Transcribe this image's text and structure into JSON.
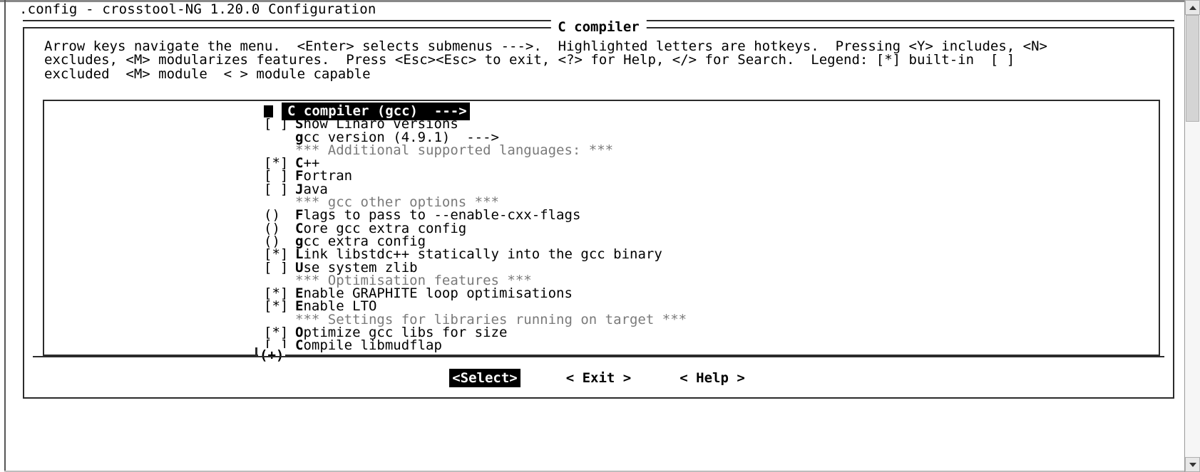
{
  "window": {
    "title": ".config - crosstool-NG 1.20.0 Configuration"
  },
  "dialog": {
    "caption": "C compiler",
    "help_lines": [
      "Arrow keys navigate the menu.  <Enter> selects submenus --->.  Highlighted letters are hotkeys.  Pressing <Y> includes, <N>",
      "excludes, <M> modularizes features.  Press <Esc><Esc> to exit, <?> for Help, </> for Search.  Legend: [*] built-in  [ ]",
      "excluded  <M> module  < > module capable"
    ],
    "more_indicator": "(+)"
  },
  "menu": {
    "items": [
      {
        "mark": "",
        "hotkey": "C",
        "rest": " compiler (gcc)",
        "arrow": "  --->",
        "kind": "submenu",
        "selected": true
      },
      {
        "mark": "[ ]",
        "hotkey": "S",
        "rest": "how Linaro versions",
        "arrow": "",
        "kind": "bool",
        "selected": false
      },
      {
        "mark": "",
        "hotkey": "g",
        "rest": "cc version (4.9.1)",
        "arrow": "  --->",
        "kind": "choice",
        "selected": false
      },
      {
        "mark": "",
        "hotkey": "",
        "rest": "*** Additional supported languages: ***",
        "arrow": "",
        "kind": "separator",
        "selected": false
      },
      {
        "mark": "[*]",
        "hotkey": "C",
        "rest": "++",
        "arrow": "",
        "kind": "bool",
        "selected": false
      },
      {
        "mark": "[ ]",
        "hotkey": "F",
        "rest": "ortran",
        "arrow": "",
        "kind": "bool",
        "selected": false
      },
      {
        "mark": "[ ]",
        "hotkey": "J",
        "rest": "ava",
        "arrow": "",
        "kind": "bool",
        "selected": false
      },
      {
        "mark": "",
        "hotkey": "",
        "rest": "*** gcc other options ***",
        "arrow": "",
        "kind": "separator",
        "selected": false
      },
      {
        "mark": "()",
        "hotkey": "F",
        "rest": "lags to pass to --enable-cxx-flags",
        "arrow": "",
        "kind": "string",
        "selected": false
      },
      {
        "mark": "()",
        "hotkey": "C",
        "rest": "ore gcc extra config",
        "arrow": "",
        "kind": "string",
        "selected": false
      },
      {
        "mark": "()",
        "hotkey": "g",
        "rest": "cc extra config",
        "arrow": "",
        "kind": "string",
        "selected": false
      },
      {
        "mark": "[*]",
        "hotkey": "L",
        "rest": "ink libstdc++ statically into the gcc binary",
        "arrow": "",
        "kind": "bool",
        "selected": false
      },
      {
        "mark": "[ ]",
        "hotkey": "U",
        "rest": "se system zlib",
        "arrow": "",
        "kind": "bool",
        "selected": false
      },
      {
        "mark": "",
        "hotkey": "",
        "rest": "*** Optimisation features ***",
        "arrow": "",
        "kind": "separator",
        "selected": false
      },
      {
        "mark": "[*]",
        "hotkey": "E",
        "rest": "nable GRAPHITE loop optimisations",
        "arrow": "",
        "kind": "bool",
        "selected": false
      },
      {
        "mark": "[*]",
        "hotkey": "E",
        "rest": "nable LTO",
        "arrow": "",
        "kind": "bool",
        "selected": false
      },
      {
        "mark": "",
        "hotkey": "",
        "rest": "*** Settings for libraries running on target ***",
        "arrow": "",
        "kind": "separator",
        "selected": false
      },
      {
        "mark": "[*]",
        "hotkey": "O",
        "rest": "ptimize gcc libs for size",
        "arrow": "",
        "kind": "bool",
        "selected": false
      },
      {
        "mark": "[ ]",
        "hotkey": "C",
        "rest": "ompile libmudflap",
        "arrow": "",
        "kind": "bool",
        "selected": false
      }
    ]
  },
  "buttons": [
    {
      "label": "<Select>",
      "active": true
    },
    {
      "label": "< Exit >",
      "active": false
    },
    {
      "label": "< Help >",
      "active": false
    }
  ],
  "scrollbar": {
    "up_arrow": "scroll-up-arrow",
    "down_arrow": "scroll-down-arrow"
  },
  "colors": {
    "foreground": "#000000",
    "background": "#ffffff",
    "highlight_bg": "#000000",
    "highlight_fg": "#ffffff",
    "separator_text": "#7a7a7a",
    "frame": "#2b2b2b"
  }
}
